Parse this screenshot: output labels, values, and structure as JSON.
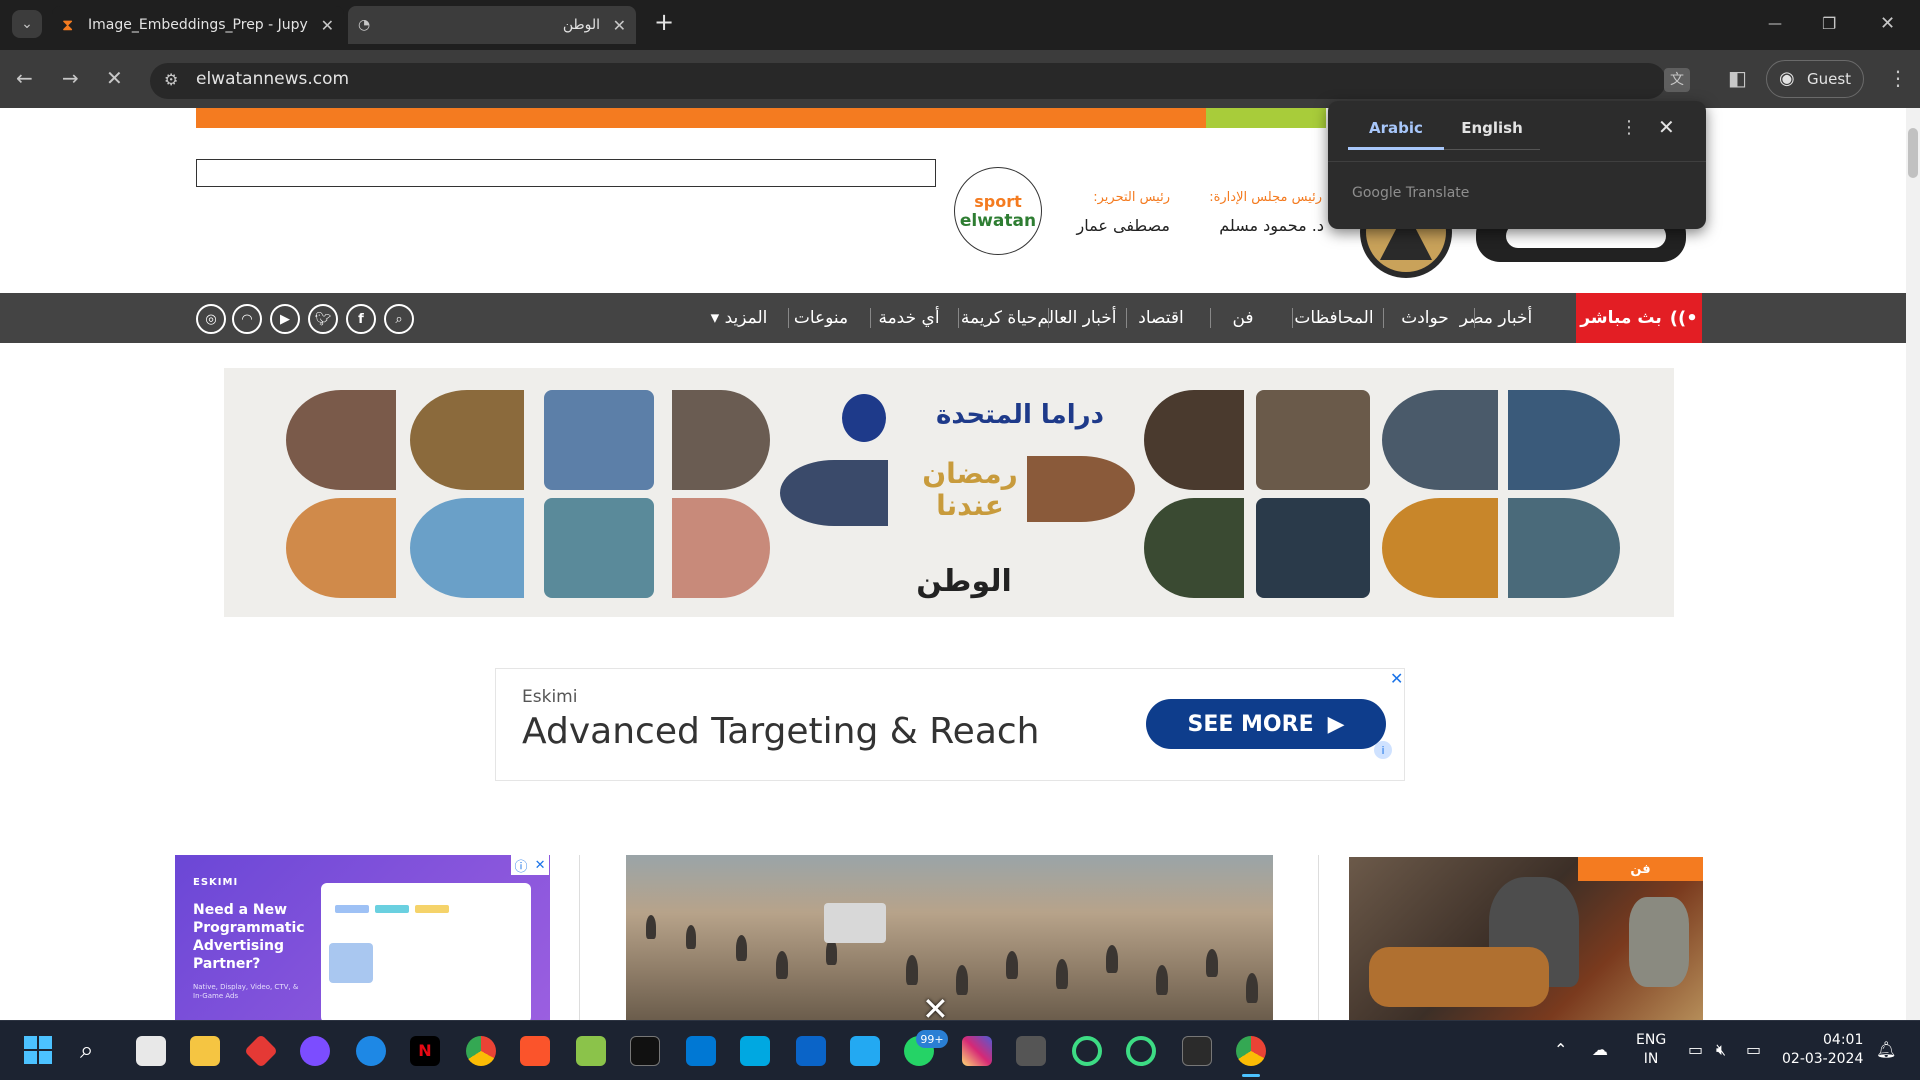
{
  "browser": {
    "tabs": [
      {
        "title": "Image_Embeddings_Prep - Jupy",
        "close": "✕"
      },
      {
        "title": "الوطن",
        "close": "✕"
      }
    ],
    "new_tab": "+",
    "url": "elwatannews.com",
    "profile_label": "Guest",
    "window_controls": {
      "minimize": "—",
      "maximize": "❐",
      "close": "✕"
    }
  },
  "translate_popup": {
    "tabs": [
      {
        "label": "Arabic",
        "selected": true
      },
      {
        "label": "English",
        "selected": false
      }
    ],
    "brand": "Google Translate",
    "menu_icon": "⋮",
    "close_icon": "✕"
  },
  "header": {
    "sport_logo": {
      "line1": "sport",
      "line2": "elwatan"
    },
    "staff": {
      "board_label": "رئيس مجلس الإدارة:",
      "board_name": "د. محمود مسلم",
      "editor_label": "رئيس التحرير:",
      "editor_name": "مصطفى عمار"
    }
  },
  "nav": {
    "live_label": "بث مباشر",
    "items": [
      "أخبار مصر",
      "حوادث",
      "المحافظات",
      "فن",
      "اقتصاد",
      "أخبار العالم",
      "حياة كريمة",
      "أي خدمة",
      "منوعات",
      "المزيد"
    ],
    "social": [
      "search-icon",
      "facebook-icon",
      "twitter-icon",
      "youtube-icon",
      "rss-icon",
      "instagram-icon"
    ]
  },
  "banner": {
    "title": "دراما المتحدة",
    "ramadan": "رمضان عندنا",
    "watermark": "الوطن"
  },
  "ad_eskimi": {
    "advertiser": "Eskimi",
    "headline": "Advanced Targeting & Reach",
    "cta": "SEE MORE",
    "close": "✕",
    "info": "i"
  },
  "ad_side": {
    "brand": "ESKIMI",
    "headline": "Need a New Programmatic Advertising Partner?",
    "sub": "Native, Display, Video, CTV, & In-Game Ads"
  },
  "article_badge": "فن",
  "overlay_close": "✕",
  "taskbar": {
    "lang_line1": "ENG",
    "lang_line2": "IN",
    "time": "04:01",
    "date": "02-03-2024",
    "whatsapp_badge": "99+"
  },
  "colors": {
    "brand_orange": "#f47b20",
    "brand_green": "#a8cc3a",
    "nav_bg": "#444444",
    "live_red": "#e31e24"
  }
}
